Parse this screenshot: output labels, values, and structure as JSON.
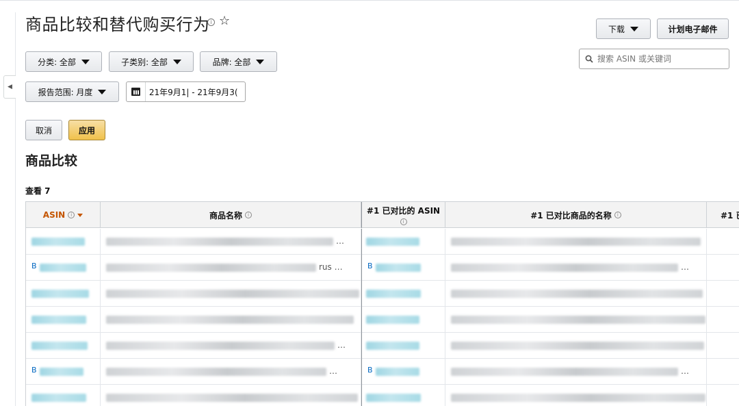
{
  "page": {
    "title": "商品比较和替代购买行为",
    "info_glyph": "i",
    "star_glyph": "☆"
  },
  "toolbar": {
    "download_label": "下载",
    "email_label": "计划电子邮件"
  },
  "search": {
    "placeholder": "搜索 ASIN 或关键词",
    "value": ""
  },
  "filters": {
    "category_label": "分类: 全部",
    "subcategory_label": "子类别: 全部",
    "brand_label": "品牌: 全部",
    "range_label": "报告范围: 月度",
    "date_value": "21年9月1| - 21年9月3("
  },
  "actions": {
    "cancel_label": "取消",
    "apply_label": "应用"
  },
  "section": {
    "title": "商品比较",
    "view_count": "查看 7"
  },
  "table": {
    "headers": {
      "asin": "ASIN",
      "product_name": "商品名称",
      "compared_asin": "#1 已对比的 ASIN",
      "compared_name": "#1 已对比商品的名称",
      "next": "#1 已"
    },
    "rows": [
      {
        "asin_prefix": "",
        "name_tail": "…",
        "cmp_prefix": "",
        "cmp_tail": ""
      },
      {
        "asin_prefix": "B",
        "name_tail": "rus …",
        "cmp_prefix": "B",
        "cmp_tail": "…"
      },
      {
        "asin_prefix": "",
        "name_tail": "",
        "cmp_prefix": "",
        "cmp_tail": ""
      },
      {
        "asin_prefix": "",
        "name_tail": "",
        "cmp_prefix": "",
        "cmp_tail": ""
      },
      {
        "asin_prefix": "",
        "name_tail": "…",
        "cmp_prefix": "",
        "cmp_tail": ""
      },
      {
        "asin_prefix": "B",
        "name_tail": "…",
        "cmp_prefix": "B",
        "cmp_tail": "…"
      },
      {
        "asin_prefix": "",
        "name_tail": "",
        "cmp_prefix": "",
        "cmp_tail": ""
      }
    ]
  },
  "colors": {
    "link": "#0066c0",
    "sort_accent": "#c45500",
    "apply_button": "#f0c14b"
  },
  "icons": {
    "search": "search-icon",
    "calendar": "calendar-icon",
    "star": "star-icon",
    "info": "info-icon",
    "collapse": "chevron-left-icon"
  }
}
